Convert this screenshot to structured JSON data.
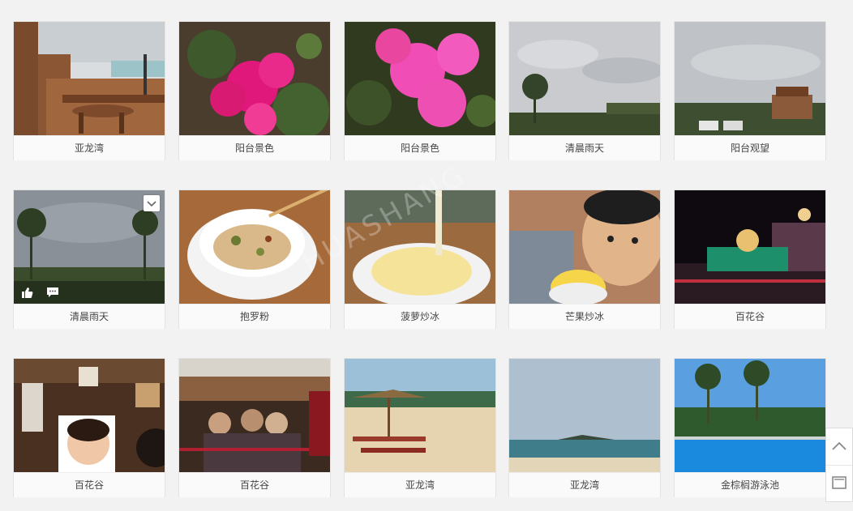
{
  "gallery": {
    "items": [
      {
        "caption": "亚龙湾"
      },
      {
        "caption": "阳台景色"
      },
      {
        "caption": "阳台景色"
      },
      {
        "caption": "清晨雨天"
      },
      {
        "caption": "阳台观望"
      },
      {
        "caption": "清晨雨天"
      },
      {
        "caption": "抱罗粉"
      },
      {
        "caption": "菠萝炒冰"
      },
      {
        "caption": "芒果炒冰"
      },
      {
        "caption": "百花谷"
      },
      {
        "caption": "百花谷"
      },
      {
        "caption": "百花谷"
      },
      {
        "caption": "亚龙湾"
      },
      {
        "caption": "亚龙湾"
      },
      {
        "caption": "金棕榈游泳池"
      }
    ]
  },
  "hover_card": {
    "icons": [
      "thumbs-up-icon",
      "comment-icon",
      "chevron-down-icon"
    ]
  },
  "side_tools": {
    "icons": [
      "chevron-up-icon",
      "frame-icon"
    ]
  },
  "colors": {
    "background": "#f2f2f2",
    "caption_text": "#444444",
    "card_border": "#e3e3e3"
  }
}
